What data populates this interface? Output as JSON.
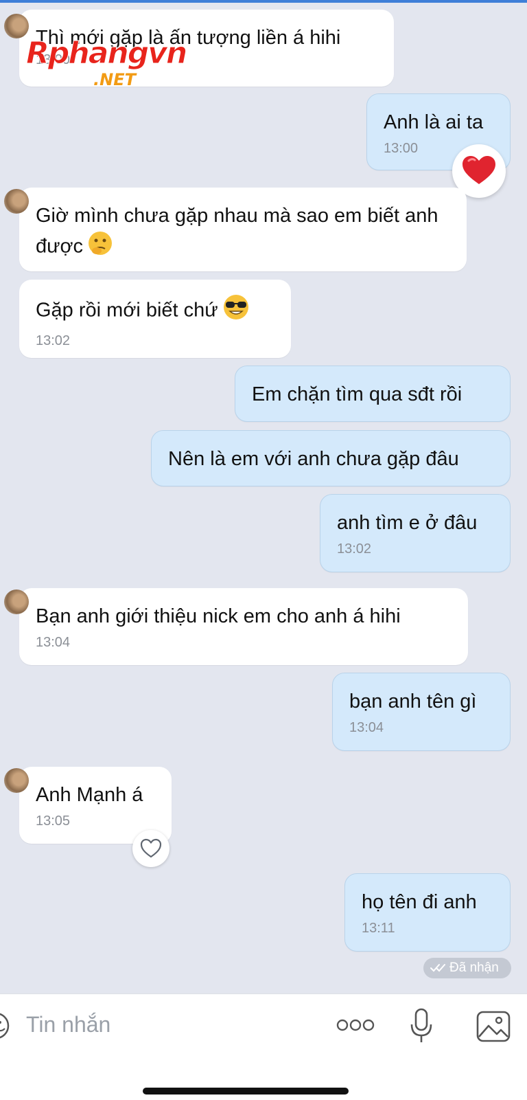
{
  "messages": [
    {
      "dir": "in",
      "text": "Thì mới gặp là ấn tượng liền á hihi",
      "time": "13:00"
    },
    {
      "dir": "out",
      "text": "Anh là ai ta",
      "time": "13:00",
      "reaction": "heart-red"
    },
    {
      "dir": "in",
      "text": "Giờ mình chưa gặp nhau mà sao em biết anh được",
      "emoji": "thinking-face-emoji"
    },
    {
      "dir": "in",
      "text": "Gặp rồi mới biết chứ",
      "time": "13:02",
      "emoji": "sunglasses-face-emoji"
    },
    {
      "dir": "out",
      "text": "Em chặn tìm qua sđt rồi"
    },
    {
      "dir": "out",
      "text": "Nên là em với anh chưa gặp đâu"
    },
    {
      "dir": "out",
      "text": "anh tìm e ở đâu",
      "time": "13:02"
    },
    {
      "dir": "in",
      "text": "Bạn anh giới thiệu nick em cho anh á hihi",
      "time": "13:04"
    },
    {
      "dir": "out",
      "text": "bạn anh tên gì",
      "time": "13:04"
    },
    {
      "dir": "in",
      "text": "Anh Mạnh á",
      "time": "13:05",
      "reaction": "heart-outline"
    },
    {
      "dir": "out",
      "text": "họ tên đi anh",
      "time": "13:11"
    }
  ],
  "status": {
    "label": "Đã nhận",
    "icon": "double-check-icon"
  },
  "input": {
    "placeholder": "Tin nhắn"
  },
  "toolbar": {
    "icons": [
      "sticker-icon",
      "more-dots-icon",
      "microphone-icon",
      "image-icon"
    ]
  },
  "watermark": {
    "main": "Rphangvn",
    "sub": ".NET"
  },
  "colors": {
    "incoming_bubble": "#ffffff",
    "outgoing_bubble": "#d4e9fb",
    "background": "#e3e6ef",
    "accent": "#3f7fd8"
  }
}
